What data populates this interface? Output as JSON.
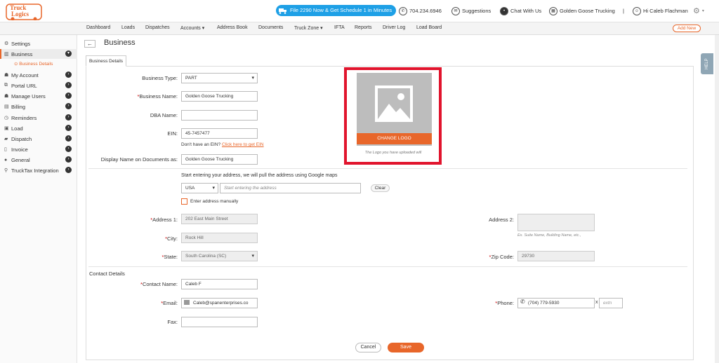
{
  "brand": {
    "logo_line1": "Truck",
    "logo_line2": "Logics"
  },
  "promo": "File 2290 Now & Get Schedule 1 in Minutes",
  "topbar": {
    "phone": "704.234.6946",
    "suggestions": "Suggestions",
    "chat": "Chat With Us",
    "company": "Golden Goose Trucking",
    "separator": "|",
    "greeting": "Hi Caleb Flachman"
  },
  "nav": [
    "Dashboard",
    "Loads",
    "Dispatches",
    "Accounts ▾",
    "Address Book",
    "Documents",
    "Truck Zone ▾",
    "IFTA",
    "Reports",
    "Driver Log",
    "Load Board"
  ],
  "add_new": "Add New",
  "sidebar": {
    "items": [
      {
        "label": "Settings"
      },
      {
        "label": "Business"
      },
      {
        "label": "My Account"
      },
      {
        "label": "Portal URL"
      },
      {
        "label": "Manage Users"
      },
      {
        "label": "Billing"
      },
      {
        "label": "Reminders"
      },
      {
        "label": "Load"
      },
      {
        "label": "Dispatch"
      },
      {
        "label": "Invoice"
      },
      {
        "label": "General"
      },
      {
        "label": "TruckTax Integration"
      }
    ],
    "sub_item": "Business Details"
  },
  "page": {
    "title": "Business",
    "tab": "Business Details"
  },
  "form": {
    "business_type": {
      "label": "Business Type:",
      "value": "PART"
    },
    "business_name": {
      "label": "Business Name:",
      "value": "Golden Goose Trucking"
    },
    "dba_name": {
      "label": "DBA Name:",
      "value": ""
    },
    "ein": {
      "label": "EIN:",
      "value": "45-7457477"
    },
    "ein_help": "Don't have an EIN?",
    "ein_link": "Click here to get EIN",
    "display_name": {
      "label": "Display Name on Documents as:",
      "value": "Golden Goose Trucking"
    },
    "address_hint": "Start entering your address, we will pull the address using Google maps",
    "country": "USA",
    "address_search_placeholder": "Start entering the address",
    "clear": "Clear",
    "manual_label": "Enter address manually",
    "address1": {
      "label": "Address 1:",
      "value": "202 East Main Street"
    },
    "address2": {
      "label": "Address 2:",
      "placeholder": "Ex. Suite Name, Building Name, etc.,"
    },
    "city": {
      "label": "City:",
      "value": "Rock Hill"
    },
    "state": {
      "label": "State:",
      "value": "South Carolina (SC)"
    },
    "zip": {
      "label": "Zip Code:",
      "value": "29730"
    },
    "contact_section": "Contact Details",
    "contact_name": {
      "label": "Contact Name:",
      "value": "Caleb F"
    },
    "email": {
      "label": "Email:",
      "value": "Caleb@spanenterprises.co"
    },
    "phone": {
      "label": "Phone:",
      "value": "(704) 779-5930",
      "ext_sep": "x",
      "ext_placeholder": "extn"
    },
    "fax": {
      "label": "Fax:",
      "value": ""
    }
  },
  "logo_panel": {
    "button": "CHANGE LOGO",
    "note": "The Logo you have uploaded will"
  },
  "actions": {
    "cancel": "Cancel",
    "save": "Save"
  },
  "help": "HELP",
  "colors": {
    "accent": "#e8662a",
    "promo": "#1ea0e6",
    "highlight": "#e1142d"
  }
}
